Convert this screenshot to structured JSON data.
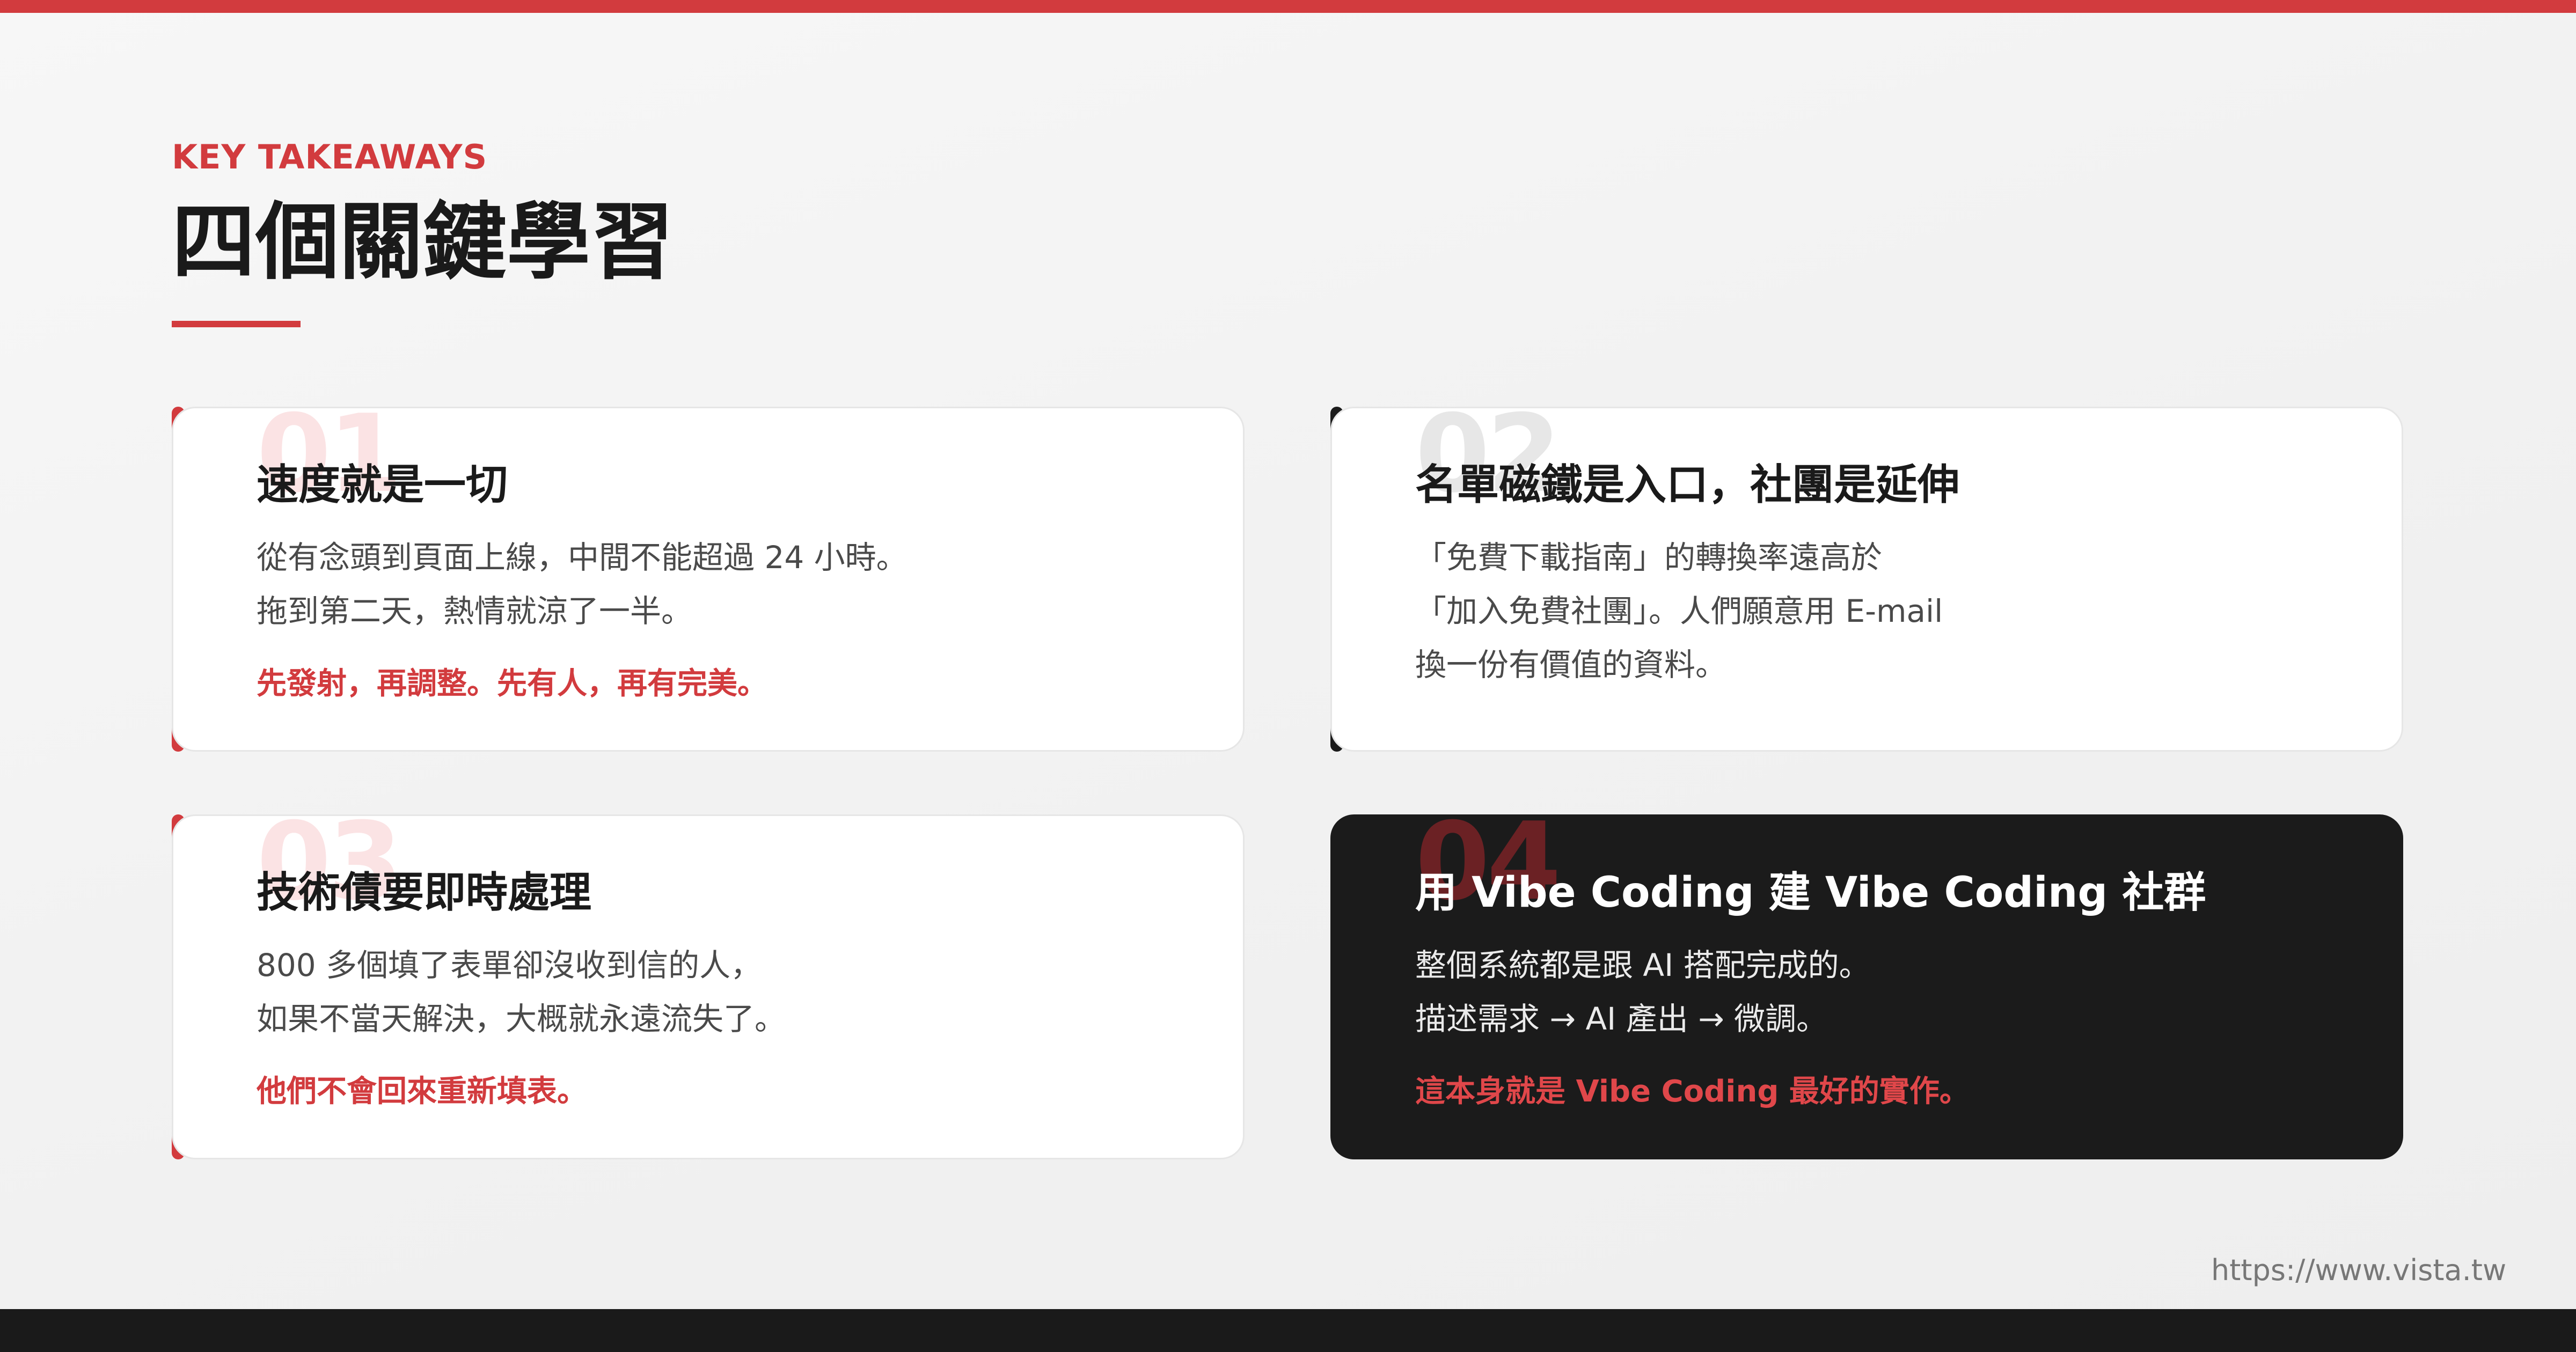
{
  "header": {
    "eyebrow": "KEY TAKEAWAYS",
    "title": "四個關鍵學習"
  },
  "cards": [
    {
      "number": "01",
      "title": "速度就是一切",
      "lines": [
        "從有念頭到頁面上線，中間不能超過 24 小時。",
        "拖到第二天，熱情就涼了一半。"
      ],
      "highlight": "先發射，再調整。先有人，再有完美。"
    },
    {
      "number": "02",
      "title": "名單磁鐵是入口，社團是延伸",
      "lines": [
        "「免費下載指南」的轉換率遠高於",
        "「加入免費社團」。人們願意用 E-mail",
        "換一份有價值的資料。"
      ]
    },
    {
      "number": "03",
      "title": "技術債要即時處理",
      "lines": [
        "800 多個填了表單卻沒收到信的人，",
        "如果不當天解決，大概就永遠流失了。"
      ],
      "highlight": "他們不會回來重新填表。"
    },
    {
      "number": "04",
      "title": "用 Vibe Coding 建 Vibe Coding 社群",
      "lines": [
        "整個系統都是跟 AI 搭配完成的。",
        "描述需求 → AI 產出 → 微調。"
      ],
      "highlight": "這本身就是 Vibe Coding 最好的實作。"
    }
  ],
  "footer": {
    "url": "https://www.vista.tw"
  },
  "colors": {
    "accent": "#d23b3e",
    "dark": "#1b1b1b",
    "background": "#f4f4f4"
  }
}
